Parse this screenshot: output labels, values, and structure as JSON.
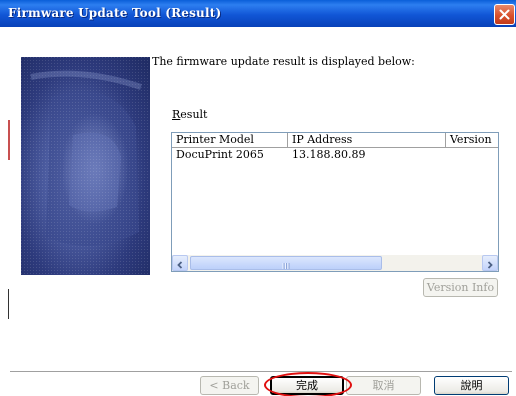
{
  "window": {
    "title": "Firmware Update Tool (Result)"
  },
  "content": {
    "intro": "The firmware update result is displayed below:",
    "result_label": "Result",
    "result_accel": "R",
    "result_rest": "esult"
  },
  "table": {
    "columns": [
      "Printer Model",
      "IP Address",
      "Version"
    ],
    "rows": [
      {
        "printer_model": "DocuPrint 2065",
        "ip_address": "13.188.80.89",
        "version": ""
      }
    ]
  },
  "buttons": {
    "version_info": "Version Info",
    "back": "< Back",
    "finish": "完成",
    "cancel": "取消",
    "help": "說明"
  },
  "states": {
    "version_info_enabled": false,
    "back_enabled": false,
    "finish_enabled": true,
    "cancel_enabled": false,
    "help_enabled": true
  },
  "icons": {
    "close": "close-icon",
    "scroll_left": "chevron-left-icon",
    "scroll_right": "chevron-right-icon",
    "thumb_grip": "grip-icon"
  },
  "colors": {
    "titlebar": "#0a54d6",
    "close_button": "#d9512d",
    "annotation_ring": "#e01010"
  }
}
